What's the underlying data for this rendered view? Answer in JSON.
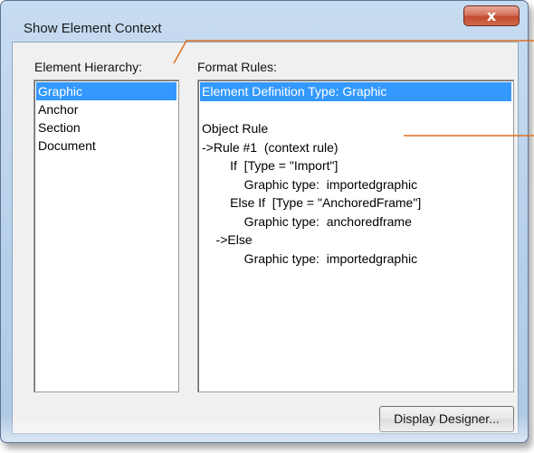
{
  "window": {
    "title": "Show Element Context"
  },
  "hierarchy": {
    "label": "Element Hierarchy:",
    "items": [
      "Graphic",
      "Anchor",
      "Section",
      "Document"
    ],
    "selected_index": 0
  },
  "format_rules": {
    "label": "Format Rules:",
    "lines": [
      "Element Definition Type: Graphic",
      "",
      "Object Rule",
      "->Rule #1  (context rule)",
      "        If  [Type = \"Import\"]",
      "            Graphic type:  importedgraphic",
      "        Else If  [Type = \"AnchoredFrame\"]",
      "            Graphic type:  anchoredframe",
      "    ->Else",
      "            Graphic type:  importedgraphic"
    ],
    "selected_index": 0
  },
  "buttons": {
    "display_designer": "Display Designer...",
    "close_symbol": "x"
  },
  "colors": {
    "selection": "#3399ff",
    "callout": "#e0701e",
    "close": "#c34a2e"
  }
}
